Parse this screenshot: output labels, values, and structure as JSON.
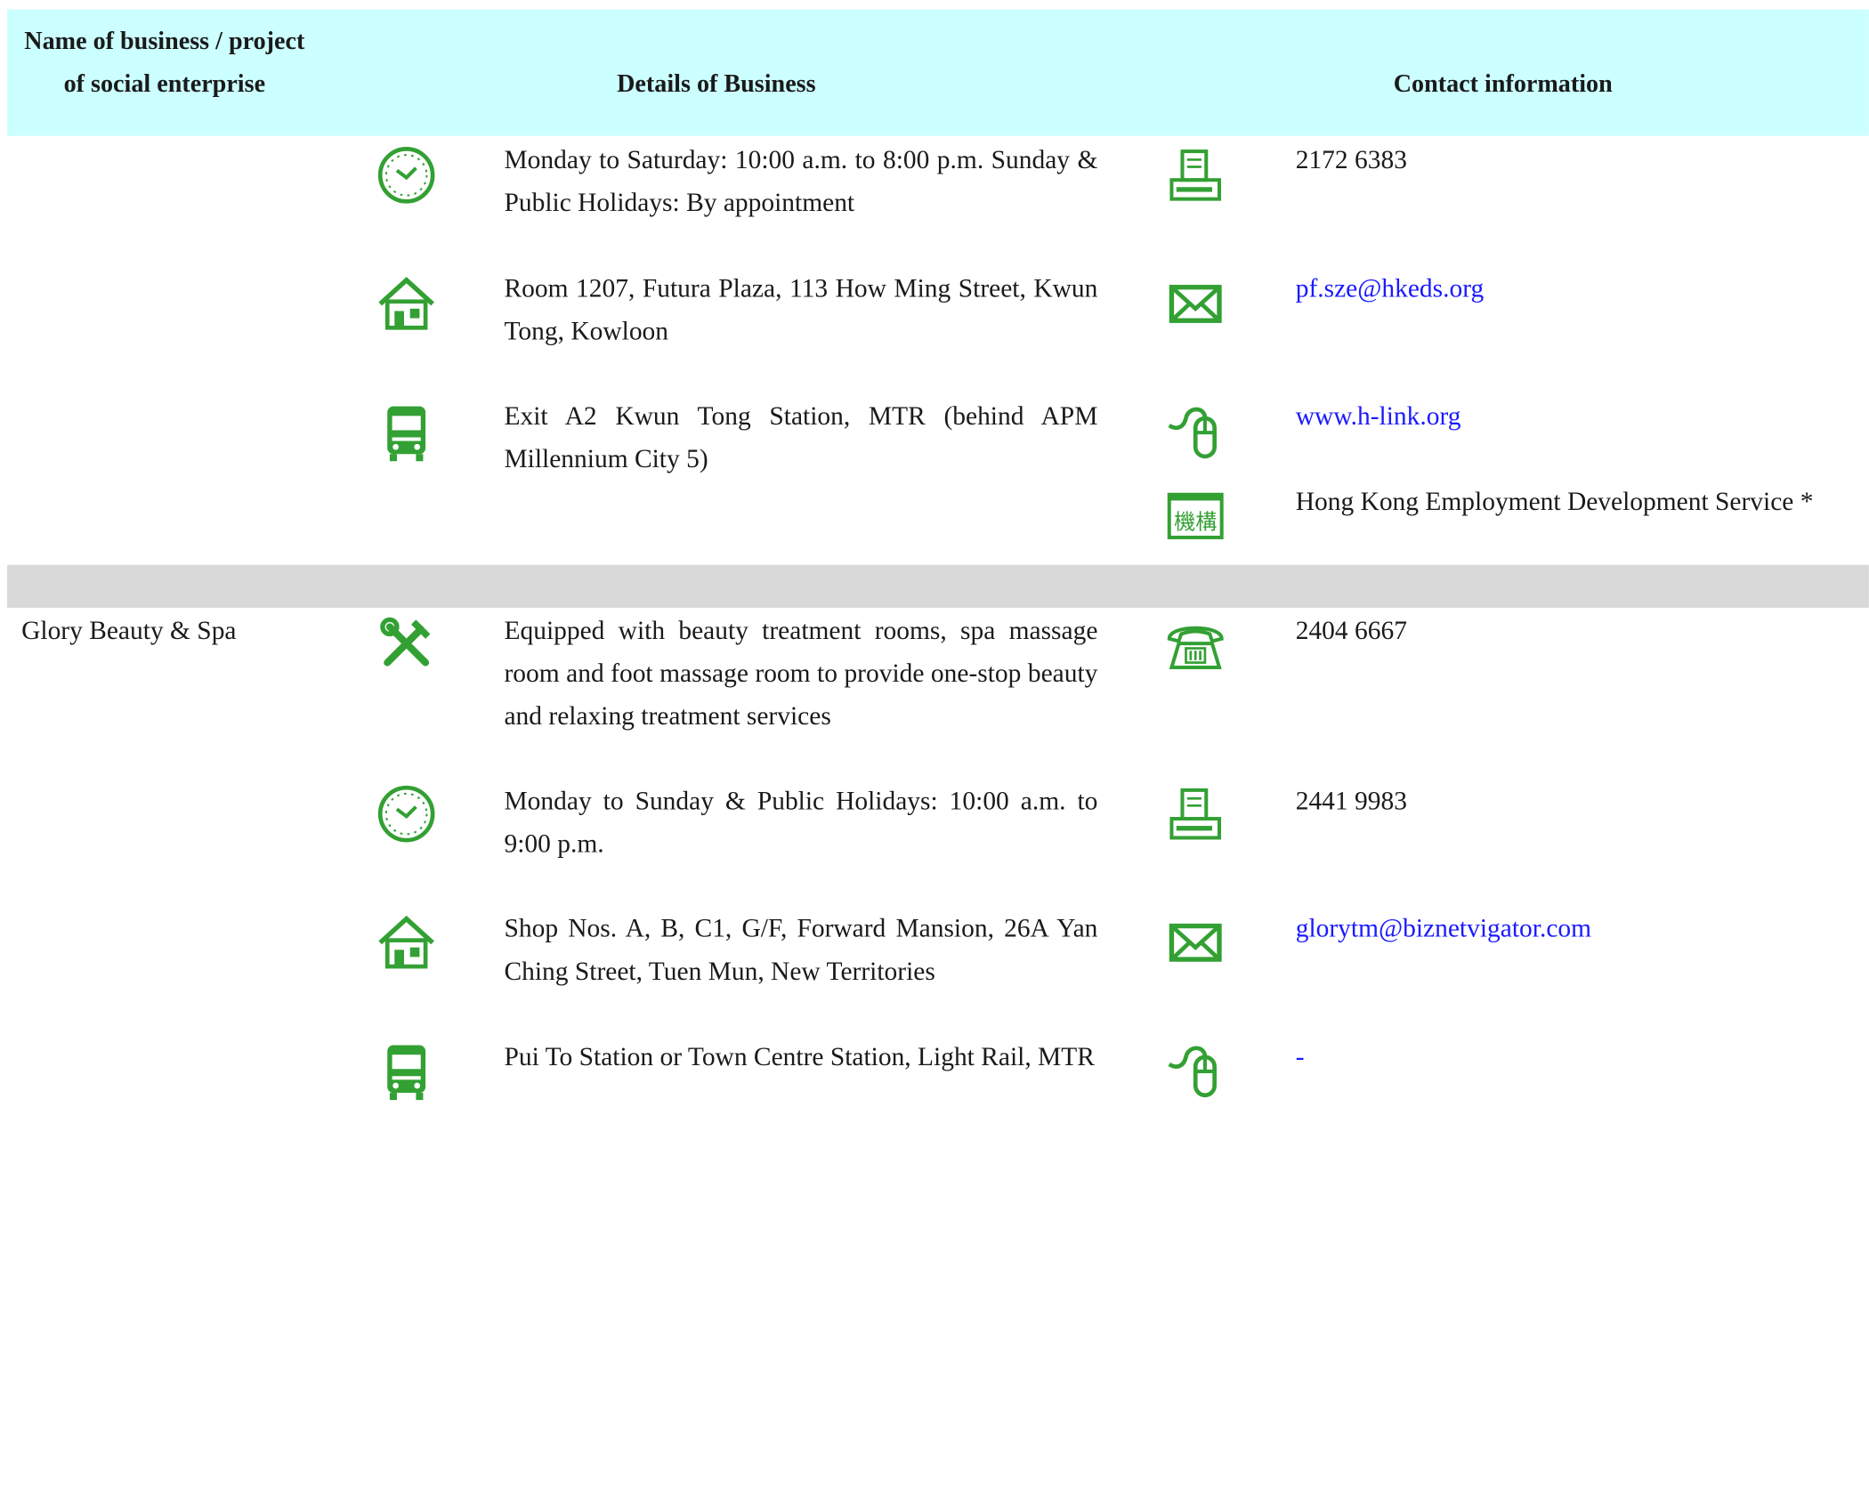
{
  "header": {
    "col_name": "Name of business / project of social enterprise",
    "col_details": "Details of Business",
    "col_contact": "Contact information"
  },
  "entry1": {
    "hours": "Monday to Saturday: 10:00 a.m. to 8:00 p.m. Sunday & Public Holidays: By appointment",
    "address": "Room 1207, Futura Plaza, 113 How Ming Street, Kwun Tong, Kowloon",
    "transport": "Exit A2 Kwun Tong Station, MTR (behind APM Millennium City 5)",
    "fax": "2172 6383",
    "email": "pf.sze@hkeds.org",
    "website": "www.h-link.org",
    "organisation": "Hong Kong Employment Development Service *"
  },
  "entry2": {
    "name": "Glory Beauty & Spa",
    "services": "Equipped with beauty treatment rooms, spa massage room and foot massage room to provide one-stop beauty and relaxing treatment services",
    "hours": "Monday to Sunday & Public Holidays: 10:00 a.m. to 9:00 p.m.",
    "address": "Shop Nos. A, B, C1, G/F, Forward Mansion, 26A Yan Ching Street, Tuen Mun, New Territories",
    "transport": "Pui To Station or Town Centre Station, Light Rail, MTR",
    "phone": "2404 6667",
    "fax": "2441 9983",
    "email": "glorytm@biznetvigator.com",
    "website": "-"
  },
  "colors": {
    "header_bg": "#ccffff",
    "separator_bg": "#d9d9d9",
    "icon_green": "#33a033",
    "link_blue": "#1a1aff"
  },
  "icons": [
    "clock-icon",
    "house-icon",
    "bus-icon",
    "tools-icon",
    "fax-icon",
    "mail-icon",
    "mouse-icon",
    "organisation-icon",
    "telephone-icon"
  ]
}
